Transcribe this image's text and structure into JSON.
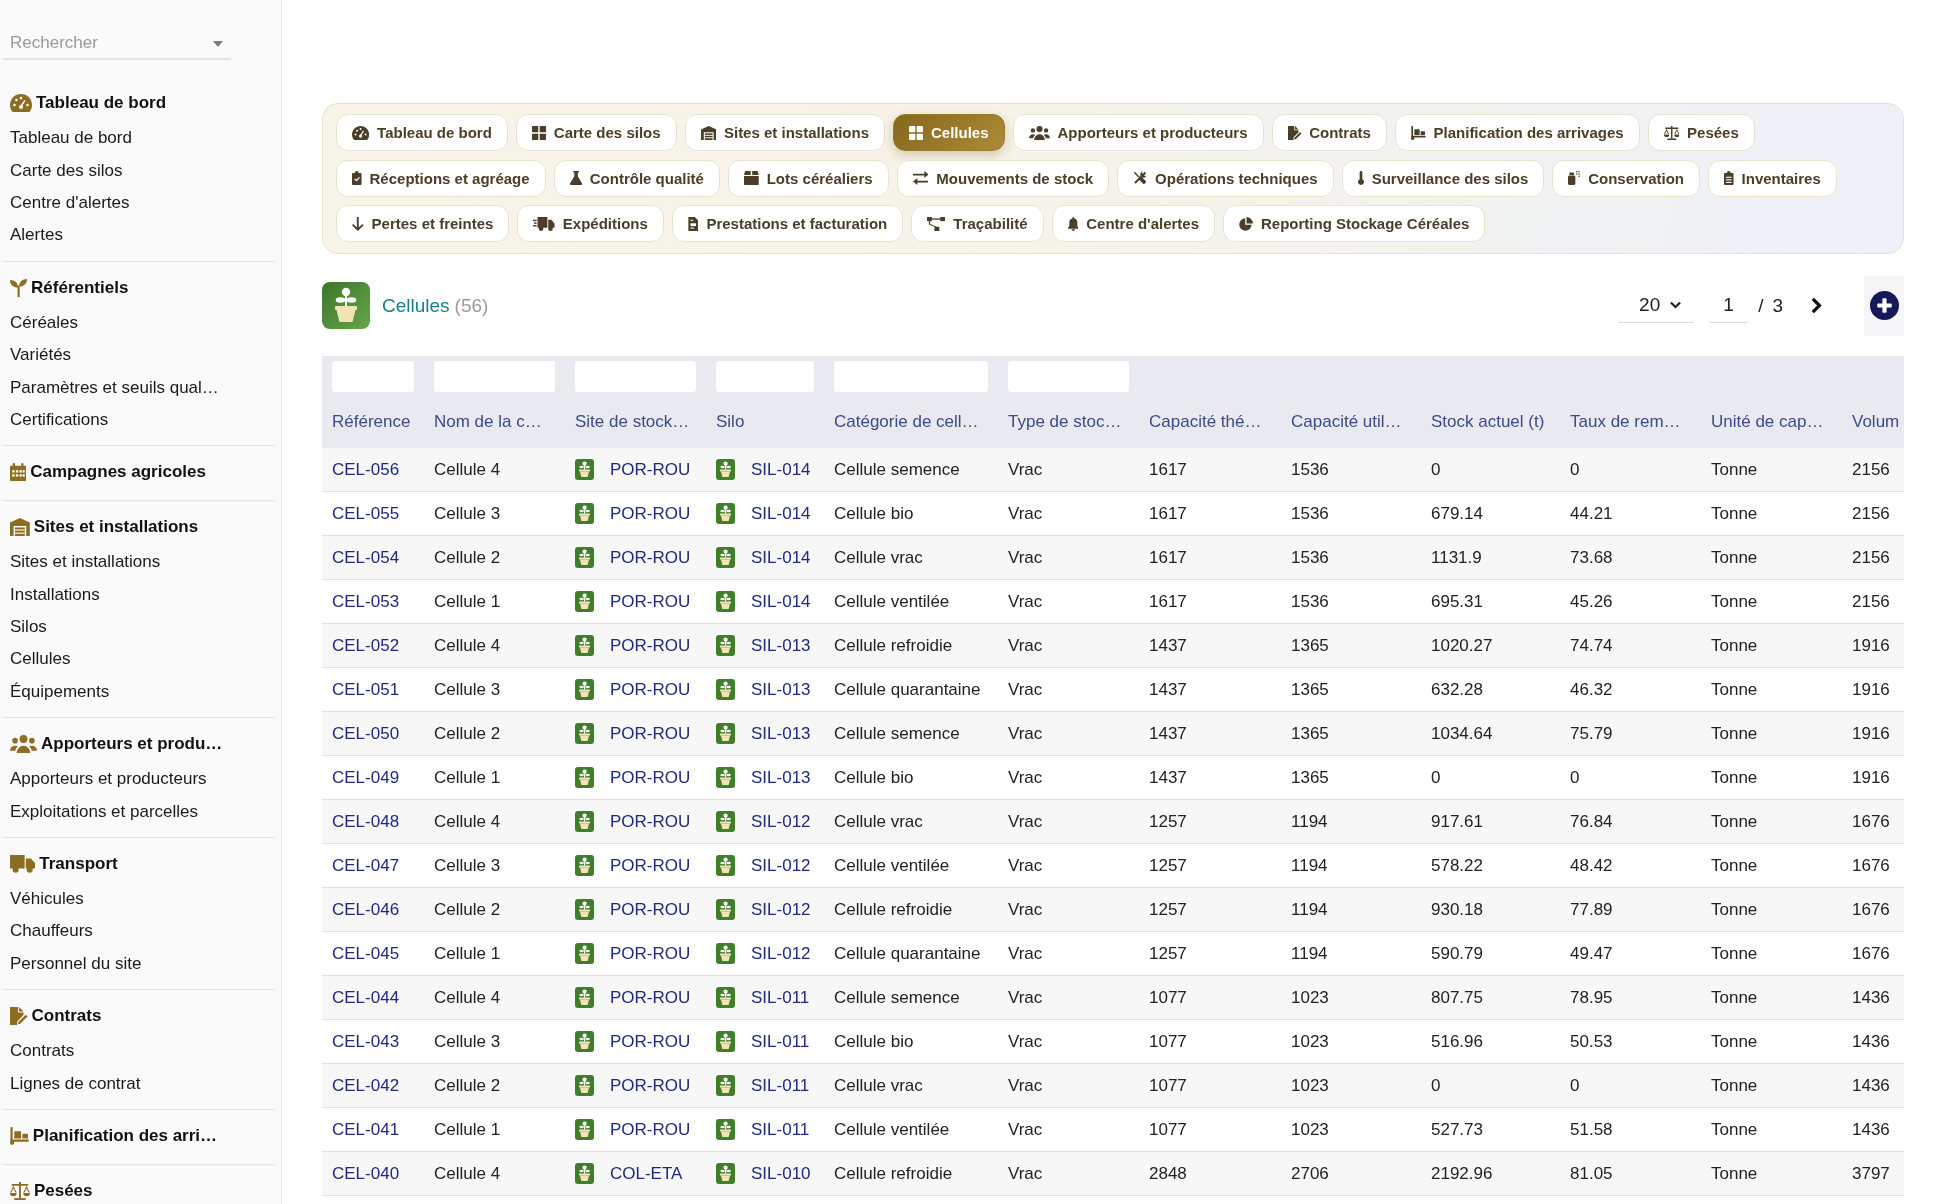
{
  "sidebar": {
    "search": {
      "placeholder": "Rechercher"
    },
    "sections": [
      {
        "title": "Tableau de bord",
        "items": [
          "Tableau de bord",
          "Carte des silos",
          "Centre d'alertes",
          "Alertes"
        ]
      },
      {
        "title": "Référentiels",
        "items": [
          "Céréales",
          "Variétés",
          "Paramètres et seuils qual…",
          "Certifications"
        ]
      },
      {
        "title": "Campagnes agricoles"
      },
      {
        "title": "Sites et installations",
        "items": [
          "Sites et installations",
          "Installations",
          "Silos",
          "Cellules",
          "Équipements"
        ]
      },
      {
        "title": "Apporteurs et produ…",
        "items": [
          "Apporteurs et producteurs",
          "Exploitations et parcelles"
        ]
      },
      {
        "title": "Transport",
        "items": [
          "Véhicules",
          "Chauffeurs",
          "Personnel du site"
        ]
      },
      {
        "title": "Contrats",
        "items": [
          "Contrats",
          "Lignes de contrat"
        ]
      },
      {
        "title": "Planification des arri…"
      },
      {
        "title": "Pesées"
      }
    ]
  },
  "module_tabs": [
    {
      "label": "Tableau de bord",
      "selected": false
    },
    {
      "label": "Carte des silos",
      "selected": false
    },
    {
      "label": "Sites et installations",
      "selected": false
    },
    {
      "label": "Cellules",
      "selected": true
    },
    {
      "label": "Apporteurs et producteurs",
      "selected": false
    },
    {
      "label": "Contrats",
      "selected": false
    },
    {
      "label": "Planification des arrivages",
      "selected": false
    },
    {
      "label": "Pesées",
      "selected": false
    },
    {
      "label": "Réceptions et agréage",
      "selected": false
    },
    {
      "label": "Contrôle qualité",
      "selected": false
    },
    {
      "label": "Lots céréaliers",
      "selected": false
    },
    {
      "label": "Mouvements de stock",
      "selected": false
    },
    {
      "label": "Opérations techniques",
      "selected": false
    },
    {
      "label": "Surveillance des silos",
      "selected": false
    },
    {
      "label": "Conservation",
      "selected": false
    },
    {
      "label": "Inventaires",
      "selected": false
    },
    {
      "label": "Pertes et freintes",
      "selected": false
    },
    {
      "label": "Expéditions",
      "selected": false
    },
    {
      "label": "Prestations et facturation",
      "selected": false
    },
    {
      "label": "Traçabilité",
      "selected": false
    },
    {
      "label": "Centre d'alertes",
      "selected": false
    },
    {
      "label": "Reporting Stockage Céréales",
      "selected": false
    }
  ],
  "page_header": {
    "title": "Cellules",
    "count": "(56)",
    "page_size": "20",
    "page": "1",
    "separator": "/",
    "page_total": "3"
  },
  "table": {
    "columns": [
      {
        "label": "Référence",
        "kind": "link",
        "filter": true
      },
      {
        "label": "Nom de la c…",
        "kind": "text",
        "filter": true
      },
      {
        "label": "Site de stock…",
        "kind": "icon-link",
        "filter": true
      },
      {
        "label": "Silo",
        "kind": "icon-link",
        "filter": true
      },
      {
        "label": "Catégorie de cell…",
        "kind": "text",
        "filter": true
      },
      {
        "label": "Type de stoc…",
        "kind": "text",
        "filter": true
      },
      {
        "label": "Capacité thé…",
        "kind": "text",
        "filter": false
      },
      {
        "label": "Capacité util…",
        "kind": "text",
        "filter": false
      },
      {
        "label": "Stock actuel (t)",
        "kind": "text",
        "filter": false
      },
      {
        "label": "Taux de rem…",
        "kind": "text",
        "filter": false
      },
      {
        "label": "Unité de cap…",
        "kind": "text",
        "filter": false
      },
      {
        "label": "Volum",
        "kind": "text",
        "filter": false
      }
    ],
    "rows": [
      [
        "CEL-056",
        "Cellule 4",
        "POR-ROU",
        "SIL-014",
        "Cellule semence",
        "Vrac",
        "1617",
        "1536",
        "0",
        "0",
        "Tonne",
        "2156"
      ],
      [
        "CEL-055",
        "Cellule 3",
        "POR-ROU",
        "SIL-014",
        "Cellule bio",
        "Vrac",
        "1617",
        "1536",
        "679.14",
        "44.21",
        "Tonne",
        "2156"
      ],
      [
        "CEL-054",
        "Cellule 2",
        "POR-ROU",
        "SIL-014",
        "Cellule vrac",
        "Vrac",
        "1617",
        "1536",
        "1131.9",
        "73.68",
        "Tonne",
        "2156"
      ],
      [
        "CEL-053",
        "Cellule 1",
        "POR-ROU",
        "SIL-014",
        "Cellule ventilée",
        "Vrac",
        "1617",
        "1536",
        "695.31",
        "45.26",
        "Tonne",
        "2156"
      ],
      [
        "CEL-052",
        "Cellule 4",
        "POR-ROU",
        "SIL-013",
        "Cellule refroidie",
        "Vrac",
        "1437",
        "1365",
        "1020.27",
        "74.74",
        "Tonne",
        "1916"
      ],
      [
        "CEL-051",
        "Cellule 3",
        "POR-ROU",
        "SIL-013",
        "Cellule quarantaine",
        "Vrac",
        "1437",
        "1365",
        "632.28",
        "46.32",
        "Tonne",
        "1916"
      ],
      [
        "CEL-050",
        "Cellule 2",
        "POR-ROU",
        "SIL-013",
        "Cellule semence",
        "Vrac",
        "1437",
        "1365",
        "1034.64",
        "75.79",
        "Tonne",
        "1916"
      ],
      [
        "CEL-049",
        "Cellule 1",
        "POR-ROU",
        "SIL-013",
        "Cellule bio",
        "Vrac",
        "1437",
        "1365",
        "0",
        "0",
        "Tonne",
        "1916"
      ],
      [
        "CEL-048",
        "Cellule 4",
        "POR-ROU",
        "SIL-012",
        "Cellule vrac",
        "Vrac",
        "1257",
        "1194",
        "917.61",
        "76.84",
        "Tonne",
        "1676"
      ],
      [
        "CEL-047",
        "Cellule 3",
        "POR-ROU",
        "SIL-012",
        "Cellule ventilée",
        "Vrac",
        "1257",
        "1194",
        "578.22",
        "48.42",
        "Tonne",
        "1676"
      ],
      [
        "CEL-046",
        "Cellule 2",
        "POR-ROU",
        "SIL-012",
        "Cellule refroidie",
        "Vrac",
        "1257",
        "1194",
        "930.18",
        "77.89",
        "Tonne",
        "1676"
      ],
      [
        "CEL-045",
        "Cellule 1",
        "POR-ROU",
        "SIL-012",
        "Cellule quarantaine",
        "Vrac",
        "1257",
        "1194",
        "590.79",
        "49.47",
        "Tonne",
        "1676"
      ],
      [
        "CEL-044",
        "Cellule 4",
        "POR-ROU",
        "SIL-011",
        "Cellule semence",
        "Vrac",
        "1077",
        "1023",
        "807.75",
        "78.95",
        "Tonne",
        "1436"
      ],
      [
        "CEL-043",
        "Cellule 3",
        "POR-ROU",
        "SIL-011",
        "Cellule bio",
        "Vrac",
        "1077",
        "1023",
        "516.96",
        "50.53",
        "Tonne",
        "1436"
      ],
      [
        "CEL-042",
        "Cellule 2",
        "POR-ROU",
        "SIL-011",
        "Cellule vrac",
        "Vrac",
        "1077",
        "1023",
        "0",
        "0",
        "Tonne",
        "1436"
      ],
      [
        "CEL-041",
        "Cellule 1",
        "POR-ROU",
        "SIL-011",
        "Cellule ventilée",
        "Vrac",
        "1077",
        "1023",
        "527.73",
        "51.58",
        "Tonne",
        "1436"
      ],
      [
        "CEL-040",
        "Cellule 4",
        "COL-ETA",
        "SIL-010",
        "Cellule refroidie",
        "Vrac",
        "2848",
        "2706",
        "2192.96",
        "81.05",
        "Tonne",
        "3797"
      ]
    ]
  }
}
